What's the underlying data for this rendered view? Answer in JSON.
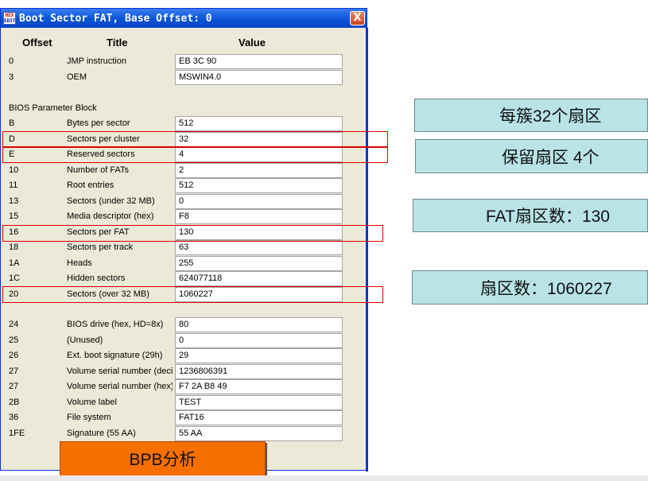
{
  "window": {
    "title": "Boot Sector FAT, Base Offset: 0",
    "close_label": "X",
    "icon_top": "HEX",
    "icon_bottom": "EDIT"
  },
  "columns": {
    "offset": "Offset",
    "title": "Title",
    "value": "Value"
  },
  "header_rows": [
    {
      "offset": "0",
      "title": "JMP instruction",
      "value": "EB 3C 90"
    },
    {
      "offset": "3",
      "title": "OEM",
      "value": "MSWIN4.0"
    }
  ],
  "section_label": "BIOS Parameter Block",
  "bpb_rows": [
    {
      "offset": "B",
      "title": "Bytes per sector",
      "value": "512"
    },
    {
      "offset": "D",
      "title": "Sectors per cluster",
      "value": "32"
    },
    {
      "offset": "E",
      "title": "Reserved sectors",
      "value": "4"
    },
    {
      "offset": "10",
      "title": "Number of FATs",
      "value": "2"
    },
    {
      "offset": "11",
      "title": "Root entries",
      "value": "512"
    },
    {
      "offset": "13",
      "title": "Sectors (under 32 MB)",
      "value": "0"
    },
    {
      "offset": "15",
      "title": "Media descriptor (hex)",
      "value": "F8"
    },
    {
      "offset": "16",
      "title": "Sectors per FAT",
      "value": "130"
    },
    {
      "offset": "18",
      "title": "Sectors per track",
      "value": "63"
    },
    {
      "offset": "1A",
      "title": "Heads",
      "value": "255"
    },
    {
      "offset": "1C",
      "title": "Hidden sectors",
      "value": "624077118"
    },
    {
      "offset": "20",
      "title": "Sectors (over 32 MB)",
      "value": "1060227"
    }
  ],
  "ext_rows": [
    {
      "offset": "24",
      "title": "BIOS drive (hex, HD=8x)",
      "value": "80"
    },
    {
      "offset": "25",
      "title": "(Unused)",
      "value": "0"
    },
    {
      "offset": "26",
      "title": "Ext. boot signature (29h)",
      "value": "29"
    },
    {
      "offset": "27",
      "title": "Volume serial number (decimal)",
      "value": "1236806391"
    },
    {
      "offset": "27",
      "title": "Volume serial number (hex)",
      "value": "F7 2A B8 49"
    },
    {
      "offset": "2B",
      "title": "Volume label",
      "value": "TEST"
    },
    {
      "offset": "36",
      "title": "File system",
      "value": "FAT16"
    },
    {
      "offset": "1FE",
      "title": "Signature (55 AA)",
      "value": "55 AA"
    }
  ],
  "annotations": {
    "sectors_per_cluster": "每簇32个扇区",
    "reserved_sectors": "保留扇区 4个",
    "fat_sectors": "FAT扇区数：130",
    "total_sectors": "扇区数：1060227"
  },
  "bpb_label": "BPB分析",
  "colors": {
    "highlight": "#e00000",
    "note_bg": "#b9e3e7",
    "bpb_bg": "#f66f00",
    "titlebar": "#0a53d6"
  }
}
